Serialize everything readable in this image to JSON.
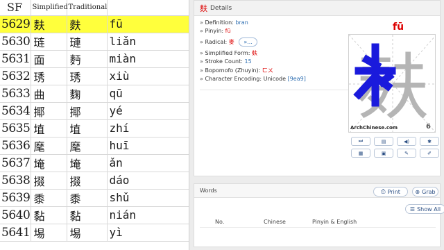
{
  "table": {
    "headers": {
      "sf": "SF",
      "simplified": "Simplified",
      "traditional": "Traditional"
    },
    "rows": [
      {
        "num": "5629",
        "simp": "麸",
        "trad": "麩",
        "pinyin": "fū",
        "selected": true
      },
      {
        "num": "5630",
        "simp": "琏",
        "trad": "璉",
        "pinyin": "liǎn"
      },
      {
        "num": "5631",
        "simp": "面",
        "trad": "麪",
        "pinyin": "miàn"
      },
      {
        "num": "5632",
        "simp": "琇",
        "trad": "琇",
        "pinyin": "xiù"
      },
      {
        "num": "5633",
        "simp": "曲",
        "trad": "麴",
        "pinyin": "qū"
      },
      {
        "num": "5634",
        "simp": "揶",
        "trad": "揶",
        "pinyin": "yé"
      },
      {
        "num": "5635",
        "simp": "埴",
        "trad": "埴",
        "pinyin": "zhí"
      },
      {
        "num": "5636",
        "simp": "麾",
        "trad": "麾",
        "pinyin": "huī"
      },
      {
        "num": "5637",
        "simp": "埯",
        "trad": "埯",
        "pinyin": "ǎn"
      },
      {
        "num": "5638",
        "simp": "掇",
        "trad": "掇",
        "pinyin": "dáo"
      },
      {
        "num": "5639",
        "simp": "黍",
        "trad": "黍",
        "pinyin": "shǔ"
      },
      {
        "num": "5640",
        "simp": "黏",
        "trad": "黏",
        "pinyin": "nián"
      },
      {
        "num": "5641",
        "simp": "埸",
        "trad": "埸",
        "pinyin": "yì"
      }
    ]
  },
  "details": {
    "char": "麸",
    "header_label": "Details",
    "pinyin_large": "fū",
    "info": {
      "definition_label": "Definition:",
      "definition_value": "bran",
      "pinyin_label": "Pinyin:",
      "pinyin_value": "fū",
      "radical_label": "Radical:",
      "radical_value": "麥",
      "radical_button": "»...",
      "simplified_label": "Simplified Form:",
      "simplified_value": "麸",
      "stroke_label": "Stroke Count:",
      "stroke_value": "15",
      "bopomofo_label": "Bopomofo (Zhuyin):",
      "bopomofo_value": "ㄈㄨ",
      "encoding_label": "Character Encoding:",
      "encoding_value": "Unicode",
      "encoding_code": "[9ea9]"
    },
    "box": {
      "char": "麸",
      "caption": "ArchChinese.com",
      "stroke_num": "6"
    },
    "controls_row1": [
      {
        "name": "play-step-button",
        "icon": "⏭"
      },
      {
        "name": "film-button",
        "icon": "▤"
      },
      {
        "name": "audio-button",
        "icon": "◀)"
      },
      {
        "name": "settings-button",
        "icon": "✱"
      }
    ],
    "controls_row2": [
      {
        "name": "worksheet-button",
        "icon": "▦"
      },
      {
        "name": "image-button",
        "icon": "▣"
      },
      {
        "name": "brush-button",
        "icon": "✎"
      },
      {
        "name": "edit-button",
        "icon": "✐"
      }
    ]
  },
  "words": {
    "title": "Words",
    "print_label": "Print",
    "grab_label": "Grab",
    "show_all_label": "Show All",
    "columns": {
      "no": "No.",
      "chinese": "Chinese",
      "pinyin_english": "Pinyin & English"
    }
  },
  "colors": {
    "selected_row": "#ffff3c",
    "highlight_red": "#dd0000",
    "link_blue": "#2b6cb0",
    "stroke_blue": "#1a1adc"
  }
}
